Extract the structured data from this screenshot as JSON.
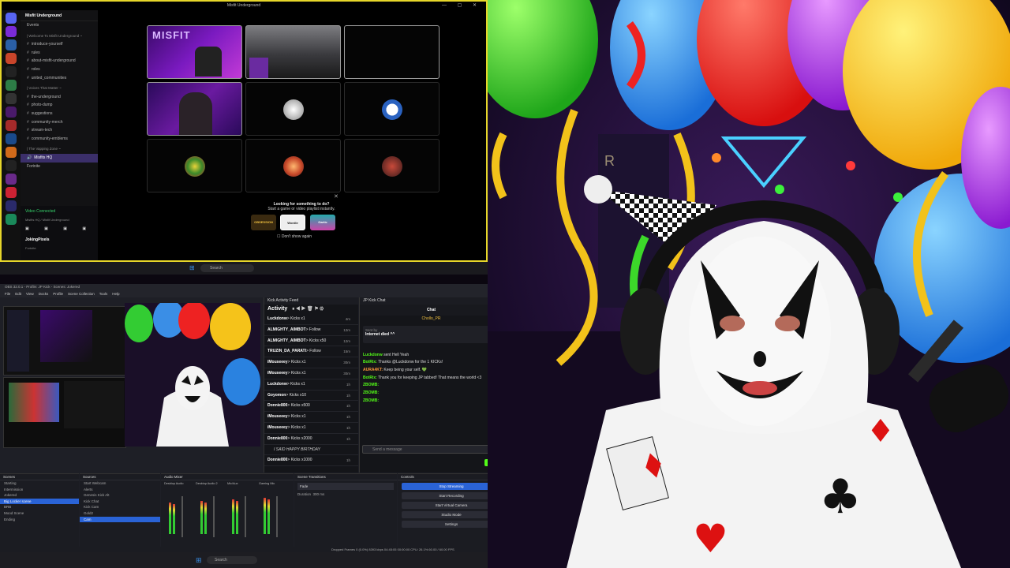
{
  "discord": {
    "window_title": "Misfit Underground",
    "server_name": "Misfit Underground",
    "channels": [
      {
        "label": "Events",
        "type": "event"
      },
      {
        "label": "| Welcome To Misfit Underground ~",
        "type": "category"
      },
      {
        "label": "introduce-yourself",
        "type": "text"
      },
      {
        "label": "rules",
        "type": "text"
      },
      {
        "label": "about-misfit-underground",
        "type": "text"
      },
      {
        "label": "roles",
        "type": "text"
      },
      {
        "label": "united_communities",
        "type": "text"
      },
      {
        "label": "| Voices That Matter ~",
        "type": "category"
      },
      {
        "label": "the-underground",
        "type": "text"
      },
      {
        "label": "photo-dump",
        "type": "text"
      },
      {
        "label": "suggestions",
        "type": "text"
      },
      {
        "label": "community-merch",
        "type": "text"
      },
      {
        "label": "stream-tech",
        "type": "text"
      },
      {
        "label": "community-emblems",
        "type": "text"
      },
      {
        "label": "| The Vapping Zone ~",
        "type": "category"
      },
      {
        "label": "Misfits HQ",
        "type": "voice-selected"
      },
      {
        "label": "Fortnite",
        "type": "activity"
      }
    ],
    "voice_status": "Video Connected",
    "voice_sub": "Misfits HQ / Misfit Underground",
    "username": "JokingPixels",
    "user_status": "Fortnite",
    "activity_prompt_title": "Looking for something to do?",
    "activity_prompt_sub": "Start a game or video playlist instantly.",
    "activities": [
      "OBSESSION",
      "Wordle",
      "Gartic"
    ],
    "dont_show": "Don't show again",
    "tile_banner": "MISFIT",
    "taskbar_search": "Search"
  },
  "obs": {
    "title": "OBS 32.0.1 - Profile: JP Kick - Scenes: Jokered",
    "menu": [
      "File",
      "Edit",
      "View",
      "Docks",
      "Profile",
      "Scene Collection",
      "Tools",
      "Help"
    ],
    "kick_feed_title": "Kick Activity Feed",
    "activity_label": "Activity",
    "feed": [
      {
        "user": "Luckdonw",
        "action": "> Kicks x1",
        "ago": "4m"
      },
      {
        "user": "ALMIGHTY_AIMBOT",
        "action": "> Follow",
        "ago": "12m"
      },
      {
        "user": "ALMIGHTY_AIMBOT",
        "action": "> Kicks x50",
        "ago": "12m"
      },
      {
        "user": "TRUZIN_DA_PARATI",
        "action": "> Follow",
        "ago": "15m"
      },
      {
        "user": "iMouseeey",
        "action": "> Kicks x1",
        "ago": "30m"
      },
      {
        "user": "iMouseeey",
        "action": "> Kicks x1",
        "ago": "30m"
      },
      {
        "user": "Luckdonw",
        "action": "> Kicks x1",
        "ago": "1h"
      },
      {
        "user": "Goyomon",
        "action": "> Kicks x10",
        "ago": "1h"
      },
      {
        "user": "Donnie800",
        "action": "> Kicks x500",
        "ago": "1h"
      },
      {
        "user": "iMouseeey",
        "action": "> Kicks x1",
        "ago": "1h"
      },
      {
        "user": "iMouseeey",
        "action": "> Kicks x1",
        "ago": "1h"
      },
      {
        "user": "Donnie800",
        "action": "> Kicks x2000",
        "ago": "1h"
      },
      {
        "user": "",
        "action": "I SAID HAPPY BIRTHDAY",
        "ago": ""
      },
      {
        "user": "Donnie800",
        "action": "> Kicks x1000",
        "ago": "1h"
      }
    ],
    "kick_chat_title": "JP Kick Chat",
    "chat_tab": "Chat",
    "chat_user": "Chollo_PR",
    "pinned_by": "Sent by",
    "pinned_text": "Internet died ^^",
    "chat_messages": [
      {
        "name": "Luckdonw",
        "text": "sent Hell Yeah",
        "cls": "n1"
      },
      {
        "name": "BotRix:",
        "text": "Thanks @Luckdonw for the 1 KICKs!",
        "cls": "n1"
      },
      {
        "name": "AURA4KT:",
        "text": "Keep being your self. 💚",
        "cls": "n2"
      },
      {
        "name": "BotRix:",
        "text": "Thank you for keeping JP tabbed! That means the world <3",
        "cls": "n1"
      },
      {
        "name": "ZBOMB:",
        "text": "",
        "cls": "n1"
      },
      {
        "name": "ZBOMB:",
        "text": "",
        "cls": "n1"
      },
      {
        "name": "ZBOMB:",
        "text": "",
        "cls": "n1"
      }
    ],
    "chat_placeholder": "Send a message",
    "chat_button": "Chat",
    "scenes_title": "Scenes",
    "scenes": [
      "Starting",
      "Intermission",
      "Jokered",
      "Big Locker scene",
      "BRB",
      "Mood Scene",
      "Ending"
    ],
    "sources_title": "Sources",
    "sources": [
      "Start Webcam",
      "Alerts",
      "Genesis Kick Alt",
      "Kick Chat",
      "Kick Cam",
      "Gold2",
      "Cam"
    ],
    "mixer_title": "Audio Mixer",
    "mixer_channels": [
      "Desktop Audio",
      "Desktop Audio 2",
      "Mic/Aux",
      "Gaming Mic"
    ],
    "transitions_title": "Scene Transitions",
    "transition_value": "Fade",
    "duration_label": "Duration",
    "duration_value": "300 ms",
    "controls_title": "Controls",
    "controls": [
      "Stop Streaming",
      "Start Recording",
      "Start Virtual Camera",
      "Studio Mode",
      "Settings"
    ],
    "status": "Dropped Frames 0 (0.0%)    8393 kbps    04:45:05    00:00:00    CPU: 26.1%    60.00 / 60.00 FPS",
    "taskbar_search": "Search"
  },
  "colors": {
    "discord_border": "#e6d62a",
    "kick_green": "#53fc18",
    "obs_blue": "#2a63d6"
  }
}
